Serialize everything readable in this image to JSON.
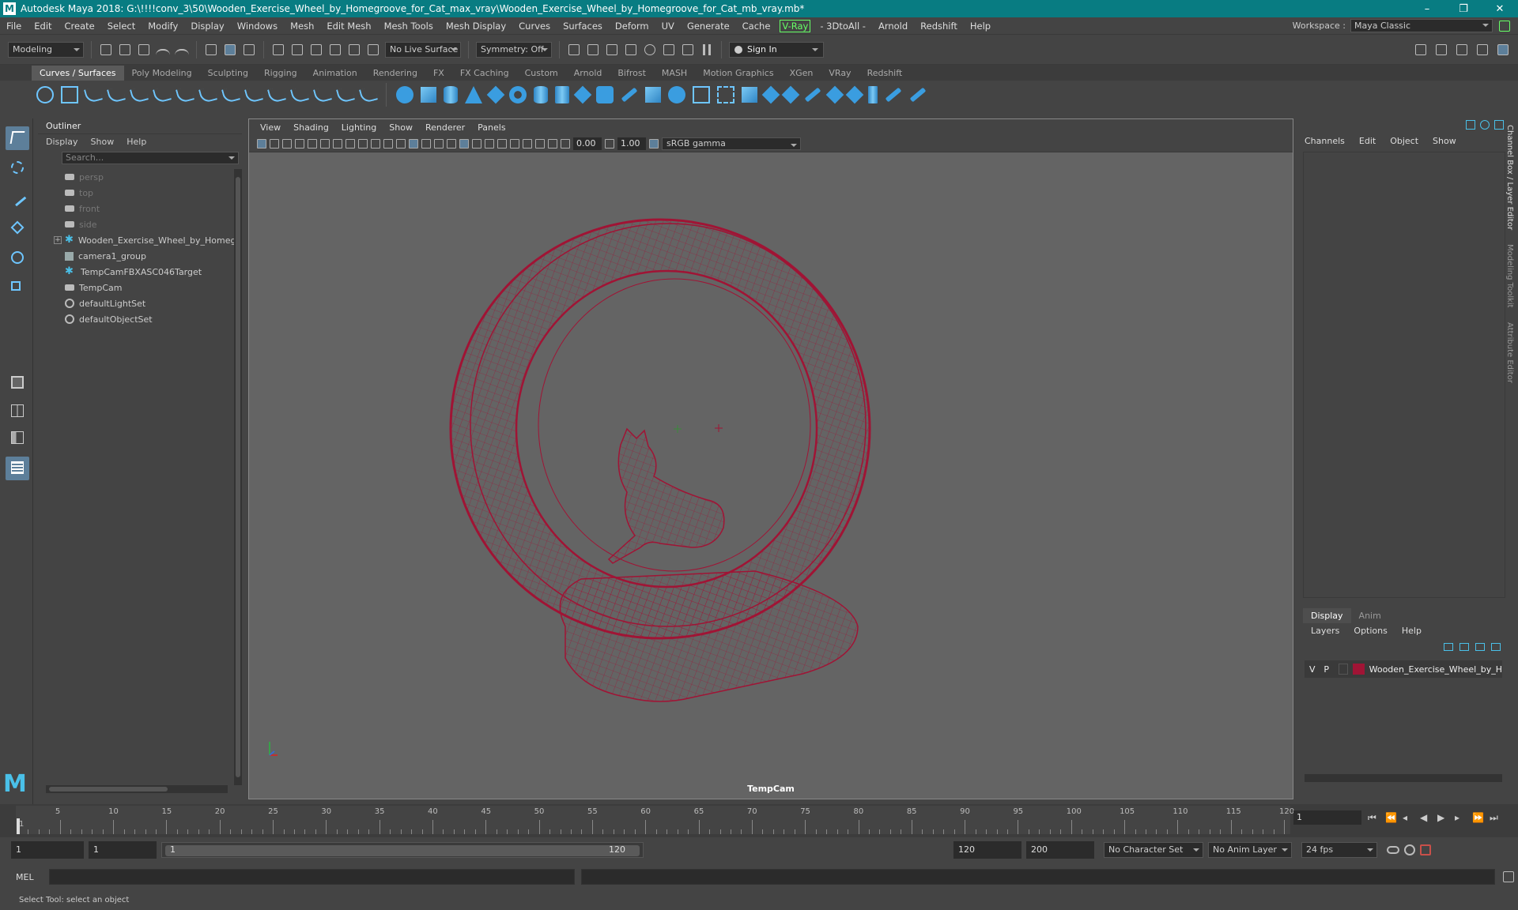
{
  "window": {
    "title": "Autodesk Maya 2018: G:\\!!!!conv_3\\50\\Wooden_Exercise_Wheel_by_Homegroove_for_Cat_max_vray\\Wooden_Exercise_Wheel_by_Homegroove_for_Cat_mb_vray.mb*",
    "minimize": "–",
    "maximize": "❐",
    "close": "✕"
  },
  "menubar": {
    "items": [
      "File",
      "Edit",
      "Create",
      "Select",
      "Modify",
      "Display",
      "Windows",
      "Mesh",
      "Edit Mesh",
      "Mesh Tools",
      "Mesh Display",
      "Curves",
      "Surfaces",
      "Deform",
      "UV",
      "Generate",
      "Cache",
      "V-Ray",
      "- 3DtoAll -",
      "Arnold",
      "Redshift",
      "Help"
    ],
    "workspace_label": "Workspace :",
    "workspace_value": "Maya Classic"
  },
  "statusline": {
    "mode": "Modeling",
    "live_surface": "No Live Surface",
    "symmetry": "Symmetry: Off",
    "sign_in": "Sign In"
  },
  "shelf": {
    "tabs": [
      "Curves / Surfaces",
      "Poly Modeling",
      "Sculpting",
      "Rigging",
      "Animation",
      "Rendering",
      "FX",
      "FX Caching",
      "Custom",
      "Arnold",
      "Bifrost",
      "MASH",
      "Motion Graphics",
      "XGen",
      "VRay",
      "Redshift"
    ],
    "active_tab": "Curves / Surfaces"
  },
  "outliner": {
    "title": "Outliner",
    "menu": [
      "Display",
      "Show",
      "Help"
    ],
    "search_placeholder": "Search...",
    "items": [
      {
        "label": "persp",
        "icon": "camera-icon",
        "dim": true
      },
      {
        "label": "top",
        "icon": "camera-icon",
        "dim": true
      },
      {
        "label": "front",
        "icon": "camera-icon",
        "dim": true
      },
      {
        "label": "side",
        "icon": "camera-icon",
        "dim": true
      },
      {
        "label": "Wooden_Exercise_Wheel_by_Homegr",
        "icon": "mesh-icon",
        "dim": false
      },
      {
        "label": "camera1_group",
        "icon": "group-icon",
        "dim": false
      },
      {
        "label": "TempCamFBXASC046Target",
        "icon": "mesh-icon",
        "dim": false
      },
      {
        "label": "TempCam",
        "icon": "camera-icon",
        "dim": false
      },
      {
        "label": "defaultLightSet",
        "icon": "set-icon",
        "dim": false
      },
      {
        "label": "defaultObjectSet",
        "icon": "set-icon",
        "dim": false
      }
    ]
  },
  "viewport": {
    "menu": [
      "View",
      "Shading",
      "Lighting",
      "Show",
      "Renderer",
      "Panels"
    ],
    "exposure": "0.00",
    "gamma": "1.00",
    "color_space": "sRGB gamma",
    "camera_name": "TempCam",
    "wire_color": "#a01435"
  },
  "channelbox": {
    "menu": [
      "Channels",
      "Edit",
      "Object",
      "Show"
    ],
    "side_tabs": [
      "Channel Box / Layer Editor",
      "Modeling Toolkit",
      "Attribute Editor"
    ]
  },
  "layer_editor": {
    "tabs": [
      "Display",
      "Anim"
    ],
    "active_tab": "Display",
    "menu": [
      "Layers",
      "Options",
      "Help"
    ],
    "layer": {
      "v": "V",
      "p": "P",
      "name": "Wooden_Exercise_Wheel_by_H",
      "color": "#a01435"
    }
  },
  "timeline": {
    "labels": [
      "5",
      "10",
      "15",
      "20",
      "25",
      "30",
      "35",
      "40",
      "45",
      "50",
      "55",
      "60",
      "65",
      "70",
      "75",
      "80",
      "85",
      "90",
      "95",
      "100",
      "105",
      "110",
      "115",
      "120"
    ],
    "first_frame_label": "1",
    "current_frame": "1"
  },
  "range": {
    "start": "1",
    "playback_start": "1",
    "slider_start": "1",
    "slider_end": "120",
    "playback_end": "120",
    "end": "200",
    "character_set": "No Character Set",
    "anim_layer": "No Anim Layer",
    "fps": "24 fps"
  },
  "command": {
    "label": "MEL"
  },
  "help_line": "Select Tool: select an object"
}
